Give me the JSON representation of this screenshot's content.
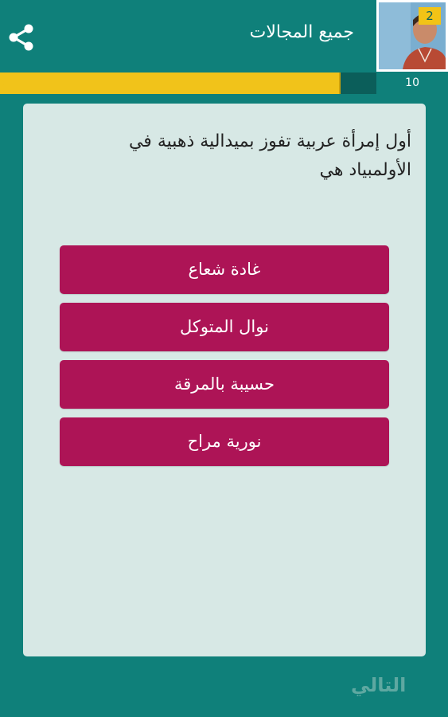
{
  "header": {
    "title": "جميع المجالات",
    "share_icon": "share-icon",
    "level": "2",
    "avatar_icon": "user-avatar"
  },
  "progress": {
    "count": "10",
    "fraction": 0.9,
    "bar_color": "#f1c31a"
  },
  "question": {
    "text": "أول إمرأة عربية تفوز بميدالية ذهبية في الأولمبياد هي"
  },
  "answers": [
    {
      "label": "غادة شعاع"
    },
    {
      "label": "نوال المتوكل"
    },
    {
      "label": "حسيبة بالمرقة"
    },
    {
      "label": "نورية مراح"
    }
  ],
  "footer": {
    "next_label": "التالي"
  },
  "colors": {
    "background": "#0f807a",
    "card": "#d7e8e5",
    "answer_button": "#ad1456",
    "next_text": "#5ea8a1"
  }
}
